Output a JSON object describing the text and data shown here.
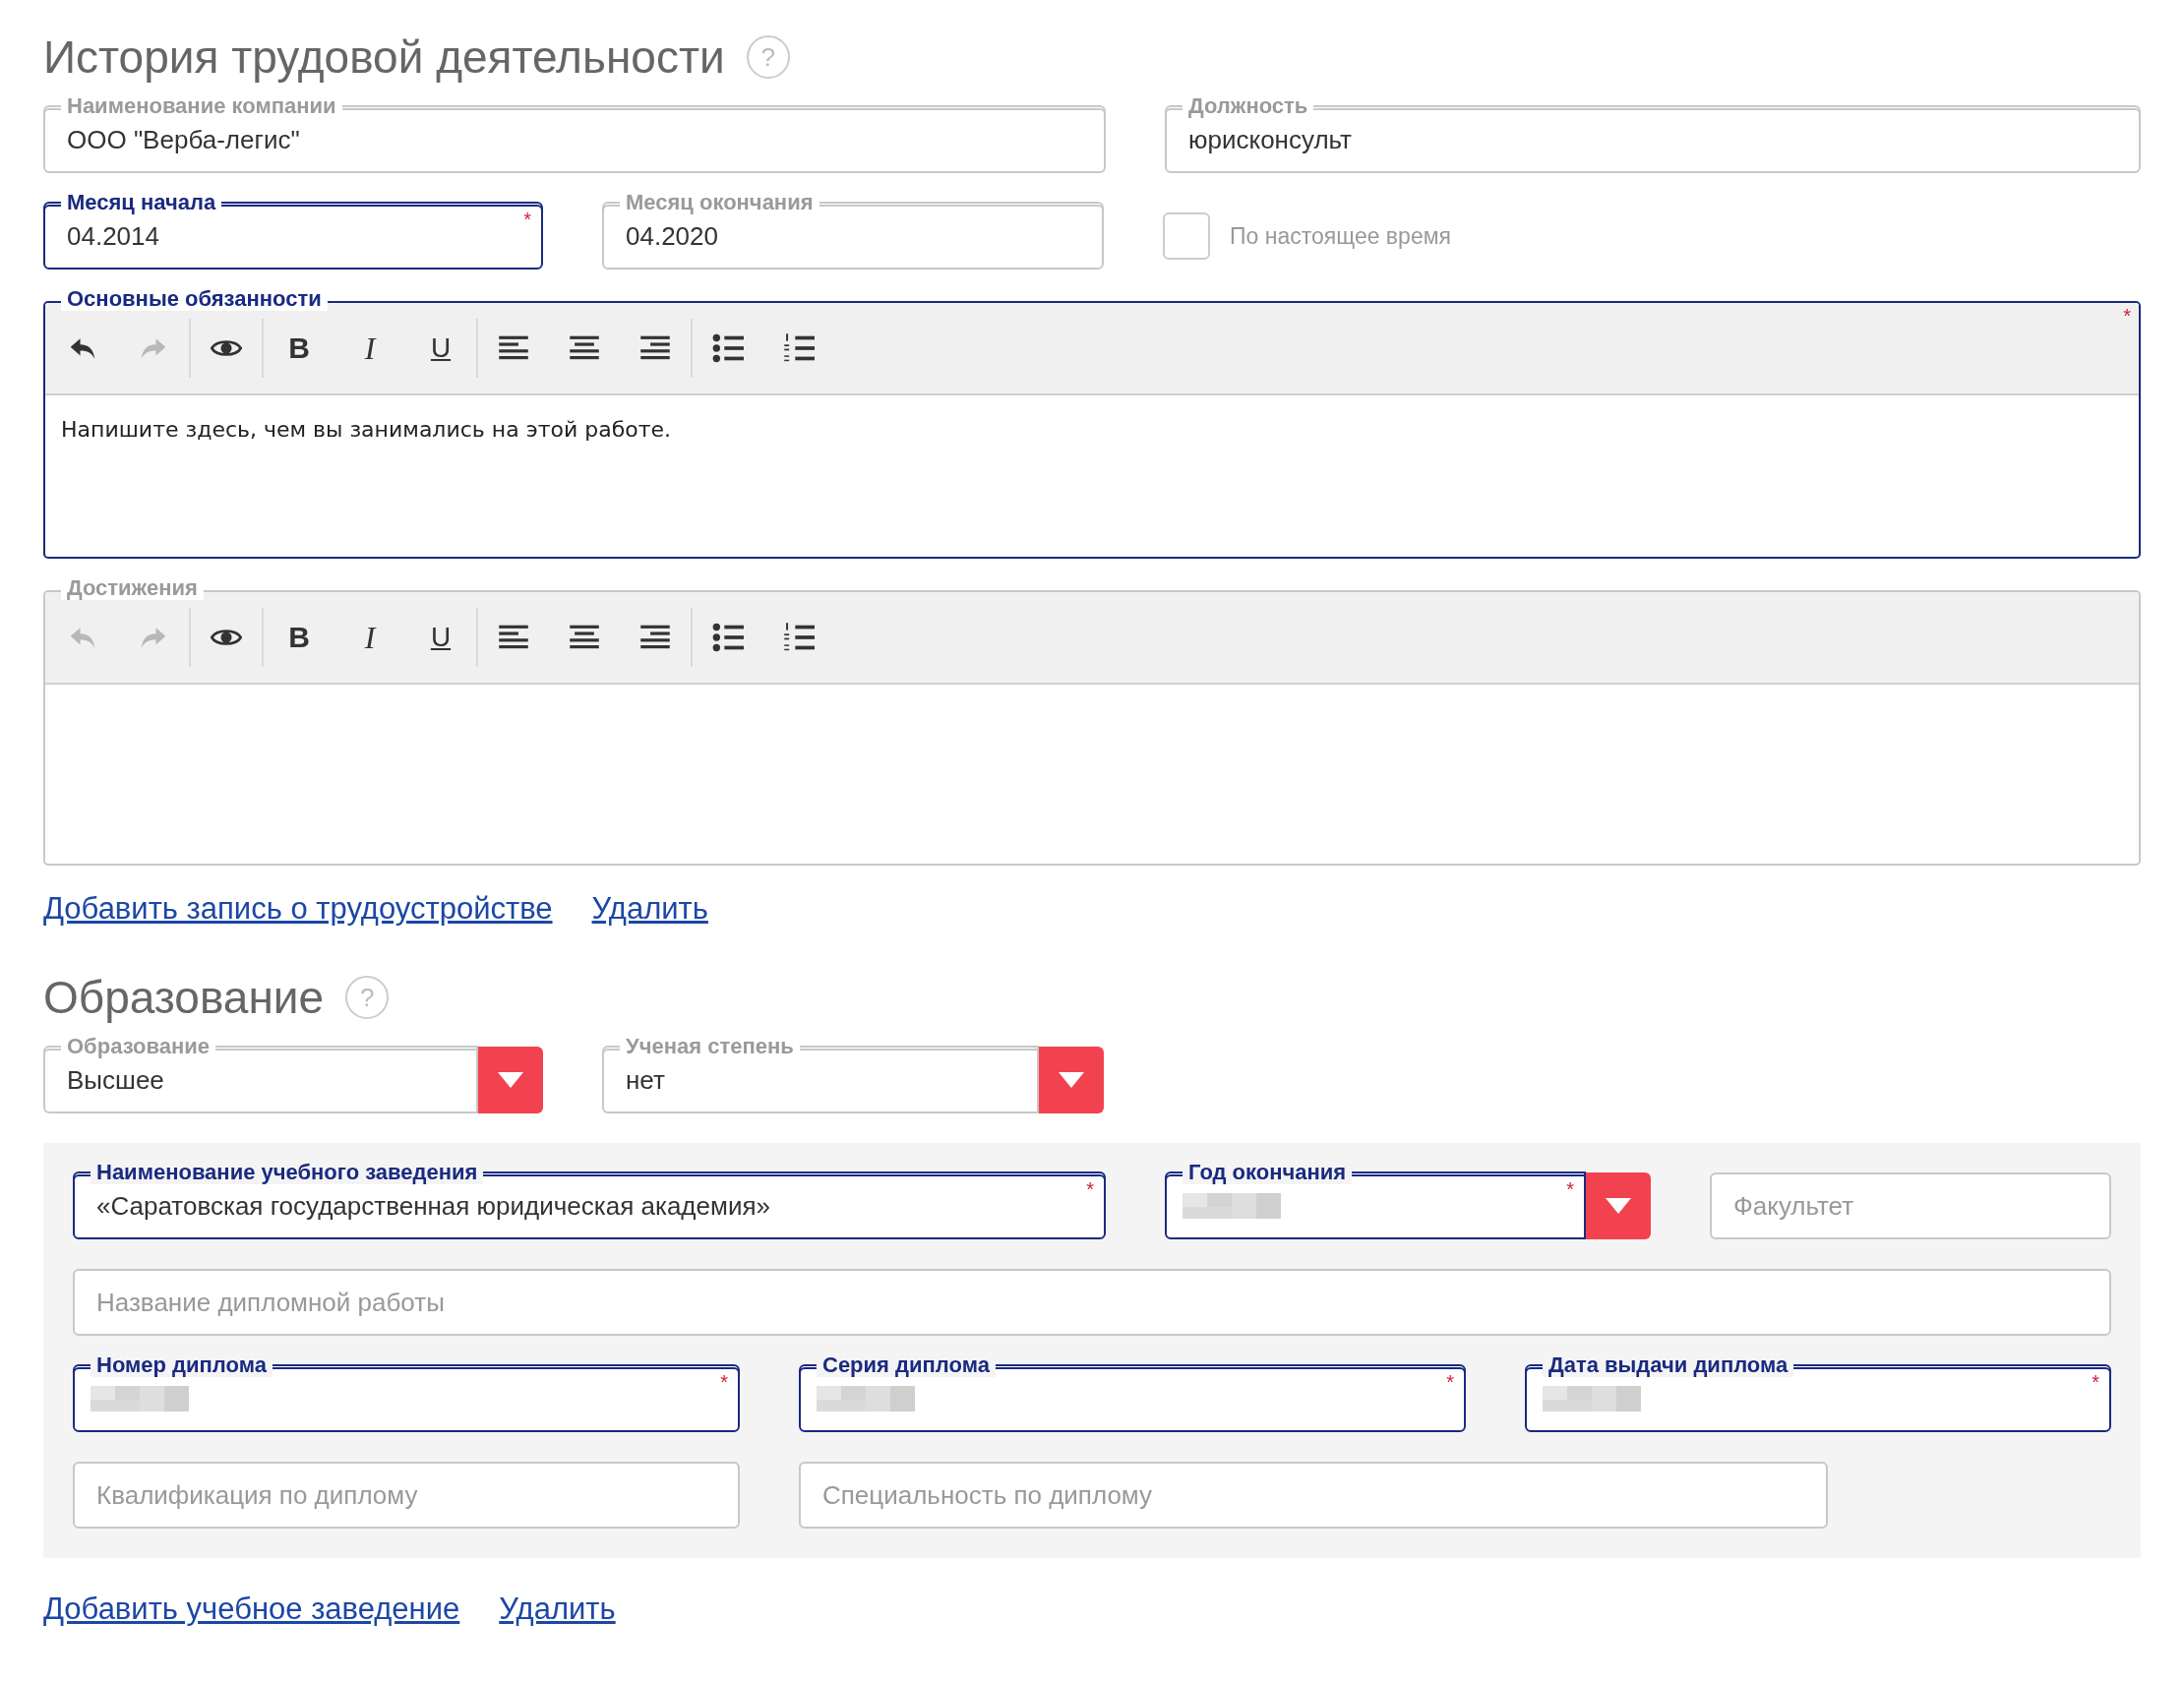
{
  "work_history": {
    "title": "История трудовой деятельности",
    "help_icon": "?",
    "fields": [
      {
        "kind": "text",
        "label": "Наименование компании",
        "value": "ООО \"Верба-легис\""
      },
      {
        "kind": "text",
        "label": "Должность",
        "value": "юрисконсульт"
      },
      {
        "kind": "text",
        "label": "Месяц начала",
        "value": "04.2014",
        "required_mark": "*"
      },
      {
        "kind": "text",
        "label": "Месяц окончания",
        "value": "04.2020"
      }
    ],
    "current_job": {
      "label": "По настоящее время",
      "checked": false
    },
    "editors": [
      {
        "label": "Основные обязанности",
        "required_mark": "*",
        "text": "Напишите здесь, чем вы занимались на этой работе.",
        "toolbar": [
          {
            "kind": "undo",
            "disabled": false
          },
          {
            "kind": "redo",
            "disabled": true
          },
          {
            "kind": "preview",
            "disabled": false
          },
          {
            "kind": "bold",
            "glyph": "B",
            "disabled": false
          },
          {
            "kind": "italic",
            "glyph": "I",
            "disabled": false
          },
          {
            "kind": "underline",
            "glyph": "U",
            "disabled": false
          },
          {
            "kind": "align-left",
            "disabled": false
          },
          {
            "kind": "align-center",
            "disabled": false
          },
          {
            "kind": "align-right",
            "disabled": false
          },
          {
            "kind": "bullets",
            "disabled": false
          },
          {
            "kind": "numbers",
            "disabled": false
          }
        ]
      },
      {
        "label": "Достижения",
        "toolbar": [
          {
            "kind": "undo",
            "disabled": true
          },
          {
            "kind": "redo",
            "disabled": true
          },
          {
            "kind": "preview",
            "disabled": false
          },
          {
            "kind": "bold",
            "glyph": "B",
            "disabled": false
          },
          {
            "kind": "italic",
            "glyph": "I",
            "disabled": false
          },
          {
            "kind": "underline",
            "glyph": "U",
            "disabled": false
          },
          {
            "kind": "align-left",
            "disabled": false
          },
          {
            "kind": "align-center",
            "disabled": false
          },
          {
            "kind": "align-right",
            "disabled": false
          },
          {
            "kind": "bullets",
            "disabled": false
          },
          {
            "kind": "numbers",
            "disabled": false
          }
        ]
      }
    ],
    "links": [
      "Добавить запись о трудоустройстве",
      "Удалить"
    ]
  },
  "education": {
    "title": "Образование",
    "help_icon": "?",
    "selects": [
      {
        "kind": "select",
        "label": "Образование",
        "value": "Высшее"
      },
      {
        "kind": "select",
        "label": "Ученая степень",
        "value": "нет"
      }
    ],
    "institution": {
      "fields": [
        {
          "kind": "text",
          "label": "Наименование учебного заведения",
          "value": "«Саратовская государственная юридическая академия»",
          "required_mark": "*"
        },
        {
          "kind": "select",
          "label": "Год окончания",
          "redacted": true,
          "required_mark": "*"
        },
        {
          "kind": "text",
          "placeholder": "Факультет"
        },
        {
          "kind": "text",
          "placeholder": "Название дипломной работы"
        },
        {
          "kind": "text",
          "label": "Номер диплома",
          "redacted": true,
          "required_mark": "*"
        },
        {
          "kind": "text",
          "label": "Серия диплома",
          "redacted": true,
          "required_mark": "*"
        },
        {
          "kind": "text",
          "label": "Дата выдачи диплома",
          "redacted": true,
          "required_mark": "*"
        },
        {
          "kind": "text",
          "placeholder": "Квалификация по диплому"
        },
        {
          "kind": "text",
          "placeholder": "Специальность по диплому"
        }
      ]
    },
    "links": [
      "Добавить учебное заведение",
      "Удалить"
    ]
  }
}
